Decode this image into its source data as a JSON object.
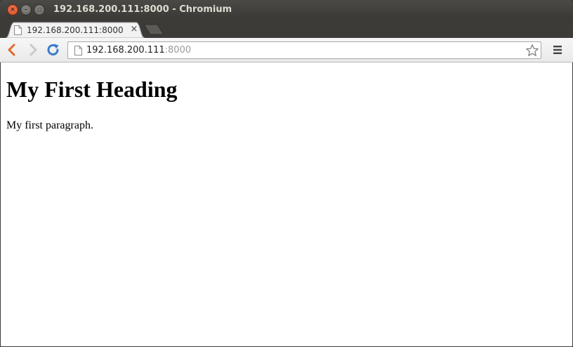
{
  "window": {
    "title": "192.168.200.111:8000 - Chromium",
    "controls": {
      "close_glyph": "×",
      "minimize_glyph": "–",
      "maximize_glyph": "▫"
    }
  },
  "tabs": [
    {
      "title": "192.168.200.111:8000",
      "close_glyph": "×",
      "active": true,
      "icon": "page-icon"
    }
  ],
  "toolbar": {
    "back_icon": "back-arrow-icon",
    "forward_icon": "forward-arrow-icon",
    "reload_icon": "reload-icon",
    "menu_icon": "hamburger-menu-icon",
    "star_icon": "bookmark-star-icon"
  },
  "omnibox": {
    "host": "192.168.200.111",
    "port": ":8000",
    "icon": "page-icon"
  },
  "page": {
    "heading": "My First Heading",
    "paragraph": "My first paragraph."
  },
  "colors": {
    "titlebar": "#3c3b37",
    "close_button": "#e2572b",
    "back_arrow": "#e06a2c",
    "reload_arrow": "#3b7cc9",
    "page_background": "#ffffff"
  }
}
